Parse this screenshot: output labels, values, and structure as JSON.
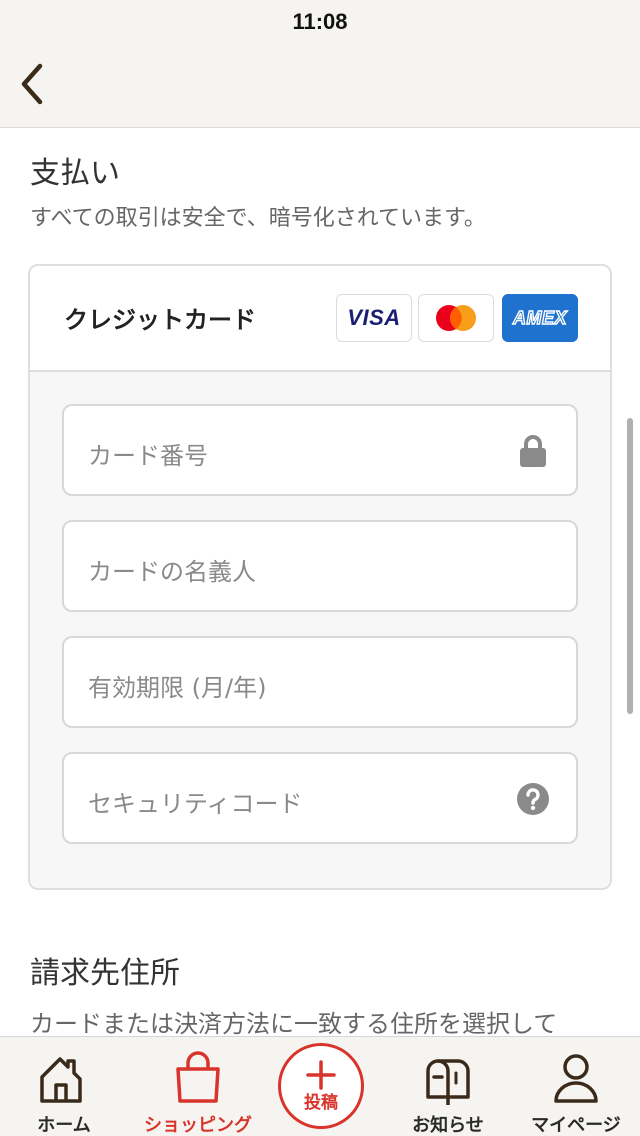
{
  "status_bar": {
    "time": "11:08"
  },
  "payment": {
    "title": "支払い",
    "subtitle": "すべての取引は安全で、暗号化されています。",
    "card": {
      "header": "クレジットカード",
      "brands": {
        "visa": "VISA",
        "mastercard": "mastercard-logo",
        "amex": "AMEX"
      },
      "fields": {
        "number": {
          "placeholder": "カード番号",
          "icon": "lock-icon"
        },
        "holder": {
          "placeholder": "カードの名義人"
        },
        "expiry": {
          "placeholder": "有効期限 (月/年)"
        },
        "cvc": {
          "placeholder": "セキュリティコード",
          "icon": "help-icon"
        }
      }
    }
  },
  "billing": {
    "title": "請求先住所",
    "subtitle": "カードまたは決済方法に一致する住所を選択して"
  },
  "tab_bar": {
    "home": "ホーム",
    "shopping": "ショッピング",
    "post": "投稿",
    "notifications": "お知らせ",
    "mypage": "マイページ",
    "active": "shopping"
  },
  "colors": {
    "accent": "#d9342b",
    "visa_blue": "#1a1f71",
    "amex_blue": "#1f72cd",
    "mc_red": "#eb001b",
    "mc_orange": "#f79e1b"
  }
}
